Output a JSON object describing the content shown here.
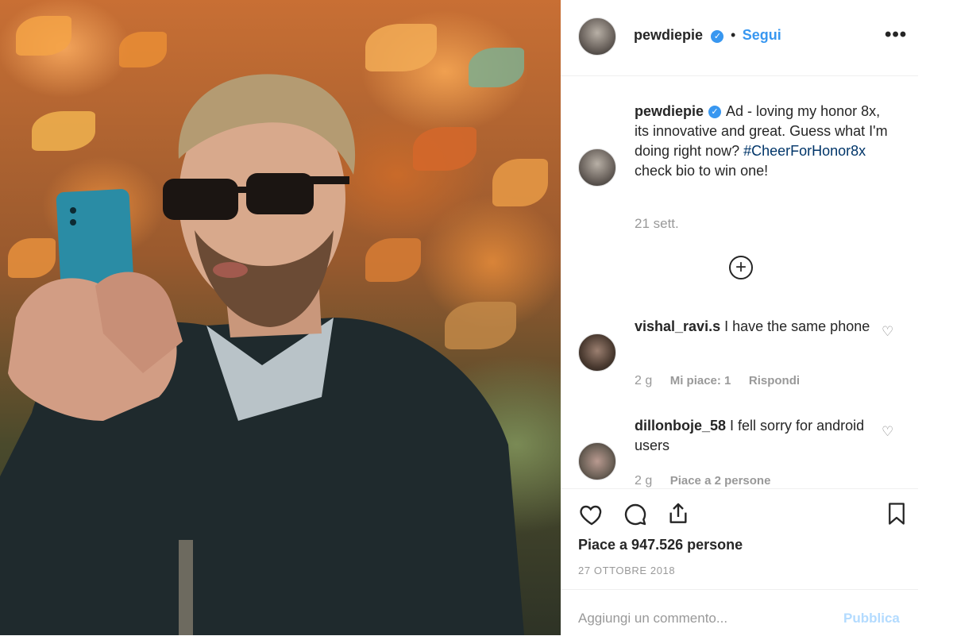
{
  "post": {
    "username": "pewdiepie",
    "verified_badge": "verified-check-icon",
    "separator": "•",
    "follow_label": "Segui",
    "more_icon": "more-options-icon"
  },
  "caption": {
    "username": "pewdiepie",
    "text_before": "Ad - loving my honor 8x, its innovative and great. Guess what I'm doing right now?",
    "hashtag": "#CheerForHonor8x",
    "text_after": "check bio to win one!",
    "time": "21 sett."
  },
  "load_more_icon": "plus-circle-icon",
  "comments": [
    {
      "username": "vishal_ravi.s",
      "text": "I have the same phone",
      "time": "2 g",
      "likes": "Mi piace: 1",
      "reply": "Rispondi"
    },
    {
      "username": "dillonboje_58",
      "text": "I fell sorry for android users",
      "time": "2 g",
      "likes": "Piace a 2 persone"
    }
  ],
  "likes_text": "Piace a 947.526 persone",
  "date": "27 OTTOBRE 2018",
  "add_comment": {
    "placeholder": "Aggiungi un commento...",
    "publish_label": "Pubblica"
  },
  "colors": {
    "accent": "#3897f0",
    "hashtag": "#003569",
    "muted": "#999999",
    "publish_disabled": "#b3dbff"
  }
}
